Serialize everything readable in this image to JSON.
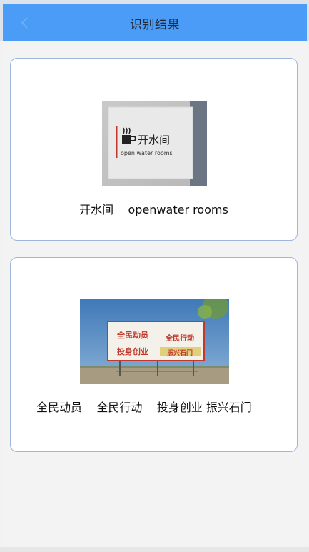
{
  "header": {
    "title": "识别结果",
    "back_icon": "chevron-left-icon",
    "background_color": "#4a9cf7"
  },
  "results": [
    {
      "caption": "开水间    openwater rooms",
      "photo": {
        "sign_cn": "开水间",
        "sign_en": "open water rooms"
      }
    },
    {
      "caption": "全民动员    全民行动    投身创业 振兴石门",
      "photo": {
        "line1_left": "全民动员",
        "line1_right": "全民行动",
        "line2_left": "投身创业",
        "line2_right": "振兴石门"
      }
    }
  ]
}
